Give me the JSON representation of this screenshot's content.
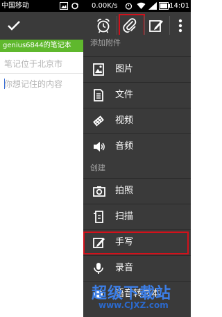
{
  "status_bar": {
    "carrier": "中国移动",
    "network_speed": "0.00K/s",
    "time": "14:01"
  },
  "notebook_bar": {
    "notebook_name": "genius6844的笔记本"
  },
  "editor": {
    "location_text": "笔记位于北京市",
    "content_placeholder": "你想记住的内容"
  },
  "menu": {
    "attach_header": "添加附件",
    "create_header": "创建",
    "attach_items": [
      {
        "label": "图片",
        "icon": "image-icon"
      },
      {
        "label": "文件",
        "icon": "file-icon"
      },
      {
        "label": "视频",
        "icon": "video-icon"
      },
      {
        "label": "音频",
        "icon": "audio-icon"
      }
    ],
    "create_items": [
      {
        "label": "拍照",
        "icon": "camera-icon"
      },
      {
        "label": "扫描",
        "icon": "scan-icon"
      },
      {
        "label": "手写",
        "icon": "handwriting-icon"
      },
      {
        "label": "录音",
        "icon": "microphone-icon"
      },
      {
        "label": "语音转文本",
        "icon": "speech-to-text-icon"
      }
    ]
  },
  "watermark": {
    "title": "超级下载站",
    "url": "www.CJXZ.com"
  },
  "colors": {
    "toolbar": "#3a3a3a",
    "notebook_bar": "#5fb82d",
    "highlight": "#d2111b",
    "menu_bg": "#3a3a3a"
  }
}
